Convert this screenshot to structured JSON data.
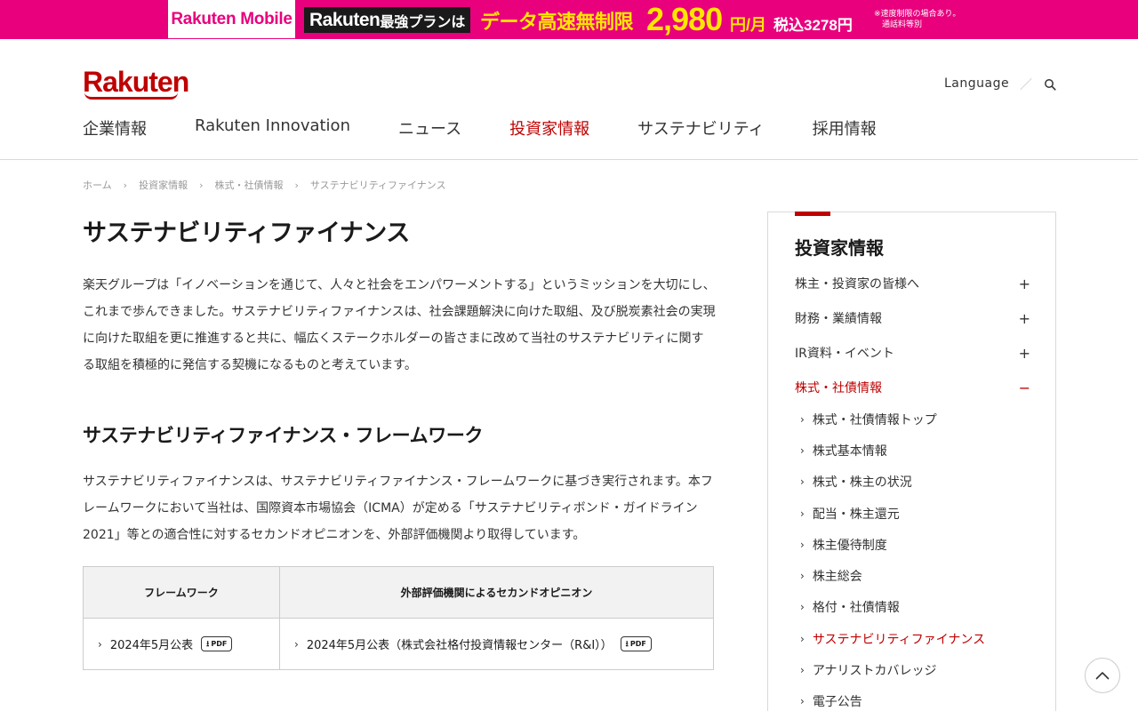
{
  "banner": {
    "brand": "Rakuten Mobile",
    "plan_prefix": "Rakuten",
    "plan_suffix": "最強プランは",
    "headline": "データ高速無制限",
    "price": "2,980",
    "unit": "円/月",
    "tax": "税込3278円",
    "note_line1": "※速度制限の場合あり。",
    "note_line2": "通話料等別"
  },
  "header": {
    "logo_text": "Rakuten",
    "language_label": "Language",
    "separator": "／",
    "nav": [
      {
        "label": "企業情報"
      },
      {
        "label": "Rakuten Innovation"
      },
      {
        "label": "ニュース"
      },
      {
        "label": "投資家情報"
      },
      {
        "label": "サステナビリティ"
      },
      {
        "label": "採用情報"
      }
    ]
  },
  "breadcrumb": {
    "items": [
      {
        "label": "ホーム"
      },
      {
        "label": "投資家情報"
      },
      {
        "label": "株式・社債情報"
      },
      {
        "label": "サステナビリティファイナンス"
      }
    ],
    "separator": "›"
  },
  "main": {
    "title": "サステナビリティファイナンス",
    "intro": "楽天グループは「イノベーションを通じて、人々と社会をエンパワーメントする」というミッションを大切にし、これまで歩んできました。サステナビリティファイナンスは、社会課題解決に向けた取組、及び脱炭素社会の実現に向けた取組を更に推進すると共に、幅広くステークホルダーの皆さまに改めて当社のサステナビリティに関する取組を積極的に発信する契機になるものと考えています。",
    "section_title": "サステナビリティファイナンス・フレームワーク",
    "section_text": "サステナビリティファイナンスは、サステナビリティファイナンス・フレームワークに基づき実行されます。本フレームワークにおいて当社は、国際資本市場協会（ICMA）が定める「サステナビリティボンド・ガイドライン2021」等との適合性に対するセカンドオピニオンを、外部評価機関より取得しています。",
    "table": {
      "headers": [
        "フレームワーク",
        "外部評価機関によるセカンドオピニオン"
      ],
      "row": {
        "framework": "2024年5月公表",
        "opinion": "2024年5月公表（株式会社格付投資情報センター（R&I））",
        "pdf_label": "PDF"
      }
    }
  },
  "sidebar": {
    "title": "投資家情報",
    "categories": [
      {
        "label": "株主・投資家の皆様へ",
        "toggle": "+"
      },
      {
        "label": "財務・業績情報",
        "toggle": "+"
      },
      {
        "label": "IR資料・イベント",
        "toggle": "+"
      },
      {
        "label": "株式・社債情報",
        "toggle": "−"
      }
    ],
    "subitems": [
      {
        "label": "株式・社債情報トップ"
      },
      {
        "label": "株式基本情報"
      },
      {
        "label": "株式・株主の状況"
      },
      {
        "label": "配当・株主還元"
      },
      {
        "label": "株主優待制度"
      },
      {
        "label": "株主総会"
      },
      {
        "label": "格付・社債情報"
      },
      {
        "label": "サステナビリティファイナンス"
      },
      {
        "label": "アナリストカバレッジ"
      },
      {
        "label": "電子公告"
      }
    ]
  },
  "colors": {
    "brand_red": "#bf0000",
    "banner_pink": "#e8007d",
    "banner_yellow": "#ffe600"
  }
}
